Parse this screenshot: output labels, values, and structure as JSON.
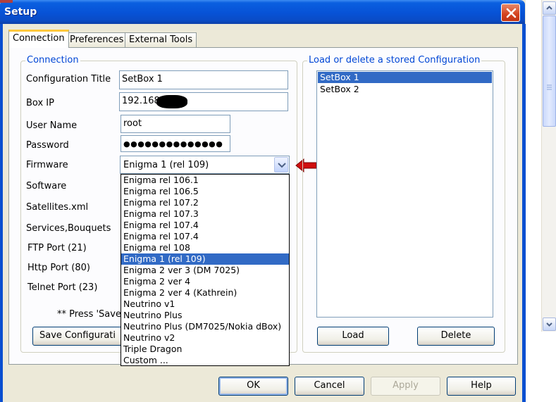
{
  "window": {
    "title": "Setup"
  },
  "tabs": [
    {
      "label": "Connection",
      "active": true
    },
    {
      "label": "Preferences",
      "active": false
    },
    {
      "label": "External Tools",
      "active": false
    }
  ],
  "connection": {
    "group_title": "Connection",
    "labels": {
      "config_title": "Configuration Title",
      "box_ip": "Box IP",
      "user_name": "User Name",
      "password": "Password",
      "firmware": "Firmware",
      "software": "Software",
      "satellites": "Satellites.xml",
      "services": "Services,Bouquets",
      "ftp_port": "FTP Port (21)",
      "http_port": "Http Port (80)",
      "telnet_port": "Telnet Port (23)"
    },
    "values": {
      "config_title": "SetBox 1",
      "box_ip": "192.168.",
      "user_name": "root",
      "password": "●●●●●●●●●●●●●●",
      "firmware": "Enigma 1 (rel 109)"
    },
    "note": "** Press 'Save",
    "save_button": "Save Configurati"
  },
  "firmware_options": [
    "Enigma rel 106.1",
    "Enigma rel 106.5",
    "Enigma rel 107.2",
    "Enigma rel 107.3",
    "Enigma rel 107.4",
    "Enigma rel 107.4",
    "Enigma rel 108",
    "Enigma 1 (rel 109)",
    "Enigma 2 ver 3 (DM 7025)",
    "Enigma 2 ver 4",
    "Enigma 2 ver 4 (Kathrein)",
    "Neutrino v1",
    "Neutrino Plus",
    "Neutrino Plus (DM7025/Nokia dBox)",
    "Neutrino v2",
    "Triple Dragon",
    "Custom ..."
  ],
  "firmware_selected_index": 7,
  "stored": {
    "group_title": "Load or delete a stored Configuration",
    "items": [
      "SetBox 1",
      "SetBox 2"
    ],
    "selected_index": 0,
    "load_button": "Load",
    "delete_button": "Delete"
  },
  "footer": {
    "ok": "OK",
    "cancel": "Cancel",
    "apply": "Apply",
    "help": "Help"
  },
  "colors": {
    "accent": "#316ac5",
    "group_title": "#0046d5",
    "titlebar": "#0752d6",
    "arrow": "#d01010"
  }
}
